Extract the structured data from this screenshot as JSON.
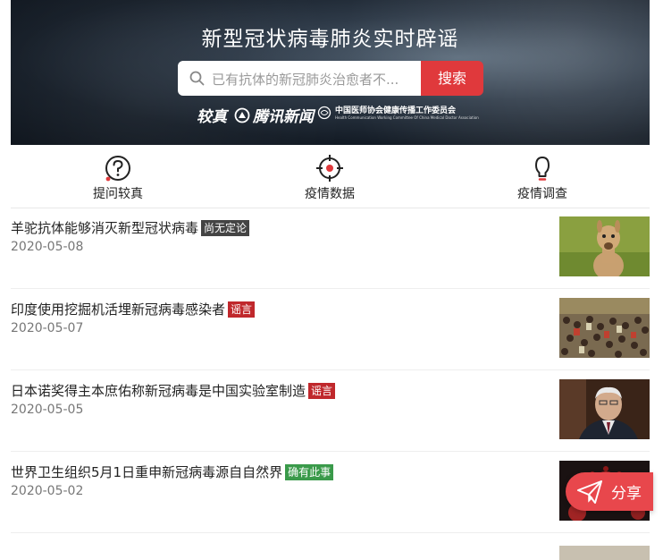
{
  "banner": {
    "title": "新型冠状病毒肺炎实时辟谣",
    "search_placeholder": "已有抗体的新冠肺炎治愈者不...",
    "search_button": "搜索",
    "logo_jiaozhen": "较真",
    "logo_tencent_news": "腾讯新闻",
    "logo_cmda": "中国医师协会健康传播工作委员会",
    "logo_cmda_sub": "Health Communication Working Committee Of China Medical Doctor Association"
  },
  "tabs": [
    {
      "label": "提问较真",
      "icon": "question-icon"
    },
    {
      "label": "疫情数据",
      "icon": "target-icon"
    },
    {
      "label": "疫情调查",
      "icon": "lightbulb-icon"
    }
  ],
  "items": [
    {
      "title": "羊驼抗体能够消灭新型冠状病毒",
      "badge": "尚无定论",
      "badge_color": "#444444",
      "date": "2020-05-08"
    },
    {
      "title": "印度使用挖掘机活埋新冠病毒感染者",
      "badge": "谣言",
      "badge_color": "#c0282c",
      "date": "2020-05-07"
    },
    {
      "title": "日本诺奖得主本庶佑称新冠病毒是中国实验室制造",
      "badge": "谣言",
      "badge_color": "#c0282c",
      "date": "2020-05-05"
    },
    {
      "title": "世界卫生组织5月1日重申新冠病毒源自自然界",
      "badge": "确有此事",
      "badge_color": "#3a9a4a",
      "date": "2020-05-02"
    }
  ],
  "share": {
    "label": "分享"
  },
  "colors": {
    "accent": "#e0393c",
    "share": "#e8474c"
  }
}
